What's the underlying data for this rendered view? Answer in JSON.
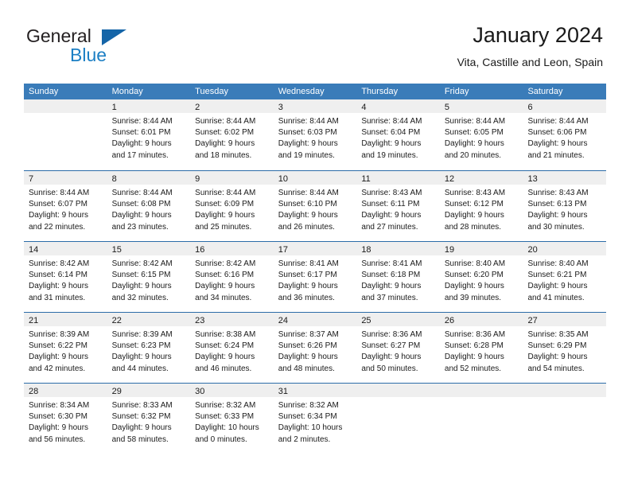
{
  "brand": {
    "name_part1": "General",
    "name_part2": "Blue",
    "accent_color": "#1c7fc4",
    "triangle_color": "#1565a8"
  },
  "header": {
    "title": "January 2024",
    "subtitle": "Vita, Castille and Leon, Spain"
  },
  "calendar": {
    "header_bg": "#3a7cb9",
    "daynum_bg": "#efefef",
    "separator_color": "#2c6ca8",
    "weekdays": [
      "Sunday",
      "Monday",
      "Tuesday",
      "Wednesday",
      "Thursday",
      "Friday",
      "Saturday"
    ],
    "weeks": [
      [
        {
          "day": "",
          "lines": []
        },
        {
          "day": "1",
          "lines": [
            "Sunrise: 8:44 AM",
            "Sunset: 6:01 PM",
            "Daylight: 9 hours",
            "and 17 minutes."
          ]
        },
        {
          "day": "2",
          "lines": [
            "Sunrise: 8:44 AM",
            "Sunset: 6:02 PM",
            "Daylight: 9 hours",
            "and 18 minutes."
          ]
        },
        {
          "day": "3",
          "lines": [
            "Sunrise: 8:44 AM",
            "Sunset: 6:03 PM",
            "Daylight: 9 hours",
            "and 19 minutes."
          ]
        },
        {
          "day": "4",
          "lines": [
            "Sunrise: 8:44 AM",
            "Sunset: 6:04 PM",
            "Daylight: 9 hours",
            "and 19 minutes."
          ]
        },
        {
          "day": "5",
          "lines": [
            "Sunrise: 8:44 AM",
            "Sunset: 6:05 PM",
            "Daylight: 9 hours",
            "and 20 minutes."
          ]
        },
        {
          "day": "6",
          "lines": [
            "Sunrise: 8:44 AM",
            "Sunset: 6:06 PM",
            "Daylight: 9 hours",
            "and 21 minutes."
          ]
        }
      ],
      [
        {
          "day": "7",
          "lines": [
            "Sunrise: 8:44 AM",
            "Sunset: 6:07 PM",
            "Daylight: 9 hours",
            "and 22 minutes."
          ]
        },
        {
          "day": "8",
          "lines": [
            "Sunrise: 8:44 AM",
            "Sunset: 6:08 PM",
            "Daylight: 9 hours",
            "and 23 minutes."
          ]
        },
        {
          "day": "9",
          "lines": [
            "Sunrise: 8:44 AM",
            "Sunset: 6:09 PM",
            "Daylight: 9 hours",
            "and 25 minutes."
          ]
        },
        {
          "day": "10",
          "lines": [
            "Sunrise: 8:44 AM",
            "Sunset: 6:10 PM",
            "Daylight: 9 hours",
            "and 26 minutes."
          ]
        },
        {
          "day": "11",
          "lines": [
            "Sunrise: 8:43 AM",
            "Sunset: 6:11 PM",
            "Daylight: 9 hours",
            "and 27 minutes."
          ]
        },
        {
          "day": "12",
          "lines": [
            "Sunrise: 8:43 AM",
            "Sunset: 6:12 PM",
            "Daylight: 9 hours",
            "and 28 minutes."
          ]
        },
        {
          "day": "13",
          "lines": [
            "Sunrise: 8:43 AM",
            "Sunset: 6:13 PM",
            "Daylight: 9 hours",
            "and 30 minutes."
          ]
        }
      ],
      [
        {
          "day": "14",
          "lines": [
            "Sunrise: 8:42 AM",
            "Sunset: 6:14 PM",
            "Daylight: 9 hours",
            "and 31 minutes."
          ]
        },
        {
          "day": "15",
          "lines": [
            "Sunrise: 8:42 AM",
            "Sunset: 6:15 PM",
            "Daylight: 9 hours",
            "and 32 minutes."
          ]
        },
        {
          "day": "16",
          "lines": [
            "Sunrise: 8:42 AM",
            "Sunset: 6:16 PM",
            "Daylight: 9 hours",
            "and 34 minutes."
          ]
        },
        {
          "day": "17",
          "lines": [
            "Sunrise: 8:41 AM",
            "Sunset: 6:17 PM",
            "Daylight: 9 hours",
            "and 36 minutes."
          ]
        },
        {
          "day": "18",
          "lines": [
            "Sunrise: 8:41 AM",
            "Sunset: 6:18 PM",
            "Daylight: 9 hours",
            "and 37 minutes."
          ]
        },
        {
          "day": "19",
          "lines": [
            "Sunrise: 8:40 AM",
            "Sunset: 6:20 PM",
            "Daylight: 9 hours",
            "and 39 minutes."
          ]
        },
        {
          "day": "20",
          "lines": [
            "Sunrise: 8:40 AM",
            "Sunset: 6:21 PM",
            "Daylight: 9 hours",
            "and 41 minutes."
          ]
        }
      ],
      [
        {
          "day": "21",
          "lines": [
            "Sunrise: 8:39 AM",
            "Sunset: 6:22 PM",
            "Daylight: 9 hours",
            "and 42 minutes."
          ]
        },
        {
          "day": "22",
          "lines": [
            "Sunrise: 8:39 AM",
            "Sunset: 6:23 PM",
            "Daylight: 9 hours",
            "and 44 minutes."
          ]
        },
        {
          "day": "23",
          "lines": [
            "Sunrise: 8:38 AM",
            "Sunset: 6:24 PM",
            "Daylight: 9 hours",
            "and 46 minutes."
          ]
        },
        {
          "day": "24",
          "lines": [
            "Sunrise: 8:37 AM",
            "Sunset: 6:26 PM",
            "Daylight: 9 hours",
            "and 48 minutes."
          ]
        },
        {
          "day": "25",
          "lines": [
            "Sunrise: 8:36 AM",
            "Sunset: 6:27 PM",
            "Daylight: 9 hours",
            "and 50 minutes."
          ]
        },
        {
          "day": "26",
          "lines": [
            "Sunrise: 8:36 AM",
            "Sunset: 6:28 PM",
            "Daylight: 9 hours",
            "and 52 minutes."
          ]
        },
        {
          "day": "27",
          "lines": [
            "Sunrise: 8:35 AM",
            "Sunset: 6:29 PM",
            "Daylight: 9 hours",
            "and 54 minutes."
          ]
        }
      ],
      [
        {
          "day": "28",
          "lines": [
            "Sunrise: 8:34 AM",
            "Sunset: 6:30 PM",
            "Daylight: 9 hours",
            "and 56 minutes."
          ]
        },
        {
          "day": "29",
          "lines": [
            "Sunrise: 8:33 AM",
            "Sunset: 6:32 PM",
            "Daylight: 9 hours",
            "and 58 minutes."
          ]
        },
        {
          "day": "30",
          "lines": [
            "Sunrise: 8:32 AM",
            "Sunset: 6:33 PM",
            "Daylight: 10 hours",
            "and 0 minutes."
          ]
        },
        {
          "day": "31",
          "lines": [
            "Sunrise: 8:32 AM",
            "Sunset: 6:34 PM",
            "Daylight: 10 hours",
            "and 2 minutes."
          ]
        },
        {
          "day": "",
          "lines": []
        },
        {
          "day": "",
          "lines": []
        },
        {
          "day": "",
          "lines": []
        }
      ]
    ]
  }
}
